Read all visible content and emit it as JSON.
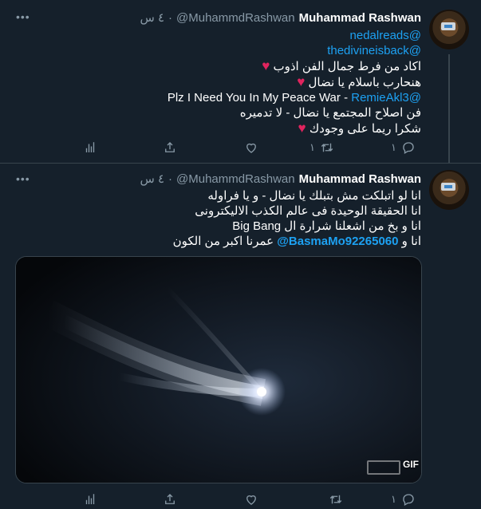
{
  "tweets": [
    {
      "name": "Muhammad Rashwan",
      "handle": "@MuhammdRashwan",
      "dot": "·",
      "time": "٤ س",
      "more": "•••",
      "lines": {
        "l1": "@nedalreads",
        "l2": "@thedivineisback",
        "l3": "اكاد من فرط جمال الفن اذوب",
        "l4": "هنحارب باسلام يا نضال",
        "l5_mention": "@RemieAkl3",
        "l5_text": "Plz I Need You In My Peace War -",
        "l6": "فن اصلاح المجتمع يا نضال - لا تدميره",
        "l7": "شكرا ريما على وجودك"
      },
      "heart": "♥",
      "counts": {
        "reply": "١",
        "retweet": "١"
      }
    },
    {
      "name": "Muhammad Rashwan",
      "handle": "@MuhammdRashwan",
      "dot": "·",
      "time": "٤ س",
      "more": "•••",
      "lines": {
        "l1": "انا لو اتبلكت مش بتبلك يا نضال - و يا فراوله",
        "l2": "انا الحقيقة الوحيدة فى عالم الكذب الاليكترونى",
        "l3": "انا و بخ من اشعلنا شرارة ال Big Bang",
        "l4_pre": "انا و",
        "l4_mention": "@BasmaMo92265060",
        "l4_post": "عمرنا اكبر من الكون"
      },
      "media_badge": "GIF",
      "counts": {
        "reply": "١",
        "retweet": ""
      }
    }
  ],
  "colors": {
    "background": "#15202b",
    "accent": "#1da1f2",
    "heart": "#e0245e",
    "muted": "#8899a6"
  }
}
